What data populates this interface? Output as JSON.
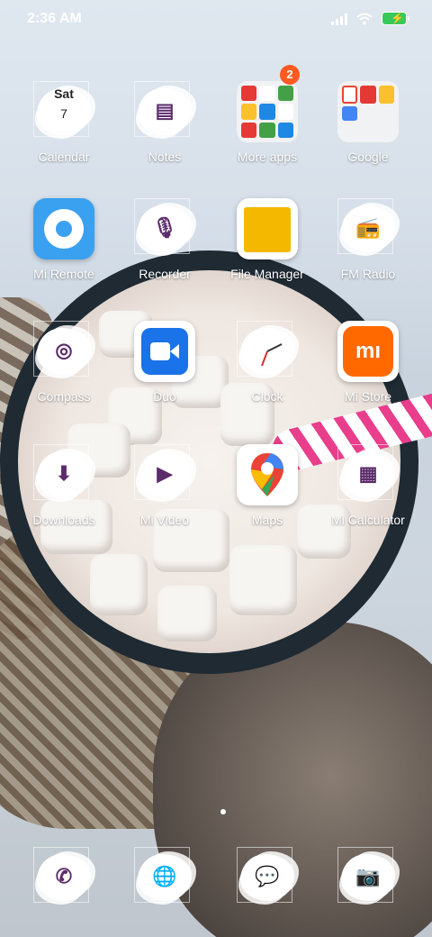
{
  "status": {
    "time": "2:36 AM"
  },
  "apps": [
    {
      "id": "calendar",
      "label": "Calendar",
      "day": "Sat",
      "date": "7"
    },
    {
      "id": "notes",
      "label": "Notes"
    },
    {
      "id": "more-apps",
      "label": "More apps",
      "badge": "2"
    },
    {
      "id": "google",
      "label": "Google"
    },
    {
      "id": "mi-remote",
      "label": "Mi Remote"
    },
    {
      "id": "recorder",
      "label": "Recorder"
    },
    {
      "id": "file-manager",
      "label": "File Manager"
    },
    {
      "id": "fm-radio",
      "label": "FM Radio"
    },
    {
      "id": "compass",
      "label": "Compass"
    },
    {
      "id": "duo",
      "label": "Duo"
    },
    {
      "id": "clock",
      "label": "Clock"
    },
    {
      "id": "mi-store",
      "label": "Mi Store"
    },
    {
      "id": "downloads",
      "label": "Downloads"
    },
    {
      "id": "mi-video",
      "label": "Mi Video"
    },
    {
      "id": "maps",
      "label": "Maps"
    },
    {
      "id": "mi-calculator",
      "label": "Mi Calculator"
    }
  ],
  "dock": [
    {
      "id": "phone",
      "icon": "phone-icon"
    },
    {
      "id": "browser",
      "icon": "globe-icon"
    },
    {
      "id": "messaging",
      "icon": "message-icon"
    },
    {
      "id": "camera",
      "icon": "camera-icon"
    }
  ],
  "colors": {
    "accent": "#5b2b6a",
    "badge": "#ff5a22",
    "battery": "#39c95a"
  }
}
